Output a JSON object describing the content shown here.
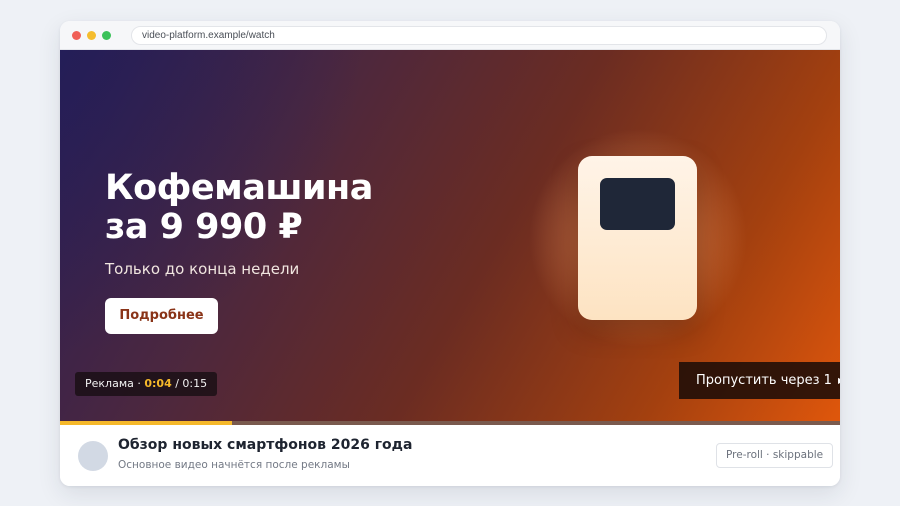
{
  "browser": {
    "url": "video-platform.example/watch"
  },
  "ad": {
    "headline_line1": "Кофемашина",
    "headline_line2": "за 9 990 ₽",
    "subline": "Только до конца недели",
    "cta_label": "Подробнее",
    "timer_label": "Реклама ·",
    "timer_current": "0:04",
    "timer_total": "/ 0:15",
    "skip_label": "Пропустить через 1",
    "progress": 0.22,
    "colors": {
      "progress_fill": "#f5b82a",
      "cta_text": "#8a3418"
    }
  },
  "video": {
    "title": "Обзор новых смартфонов 2026 года",
    "subtitle": "Основное видео начнётся после рекламы",
    "tag": "Pre-roll · skippable"
  }
}
